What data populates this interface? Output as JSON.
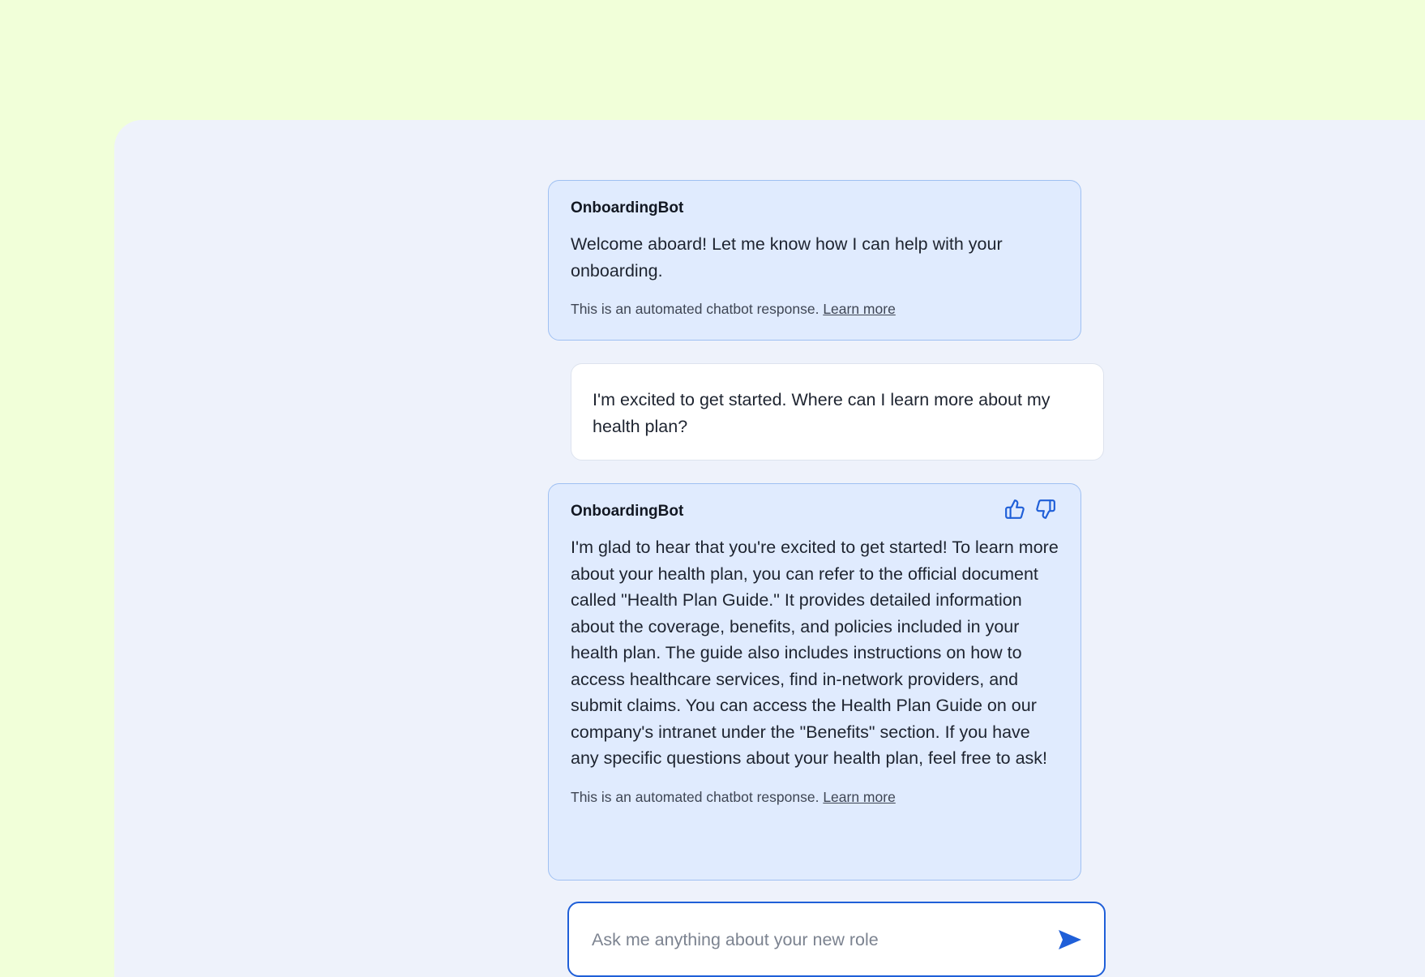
{
  "messages": [
    {
      "sender": "OnboardingBot",
      "text": "Welcome aboard! Let me know how I can help with your onboarding.",
      "disclaimer": "This is an automated chatbot response.",
      "learn_more": "Learn more"
    },
    {
      "text": "I'm excited to get started. Where can I learn more about my health plan?"
    },
    {
      "sender": "OnboardingBot",
      "text": "I'm glad to hear that you're excited to get started! To learn more about your health plan, you can refer to the official document called \"Health Plan Guide.\" It provides detailed information about the coverage, benefits, and policies included in your health plan. The guide also includes instructions on how to access healthcare services, find in-network providers, and submit claims. You can access the Health Plan Guide on our company's intranet under the \"Benefits\" section. If you have any specific questions about your health plan, feel free to ask!",
      "disclaimer": "This is an automated chatbot response.",
      "learn_more": "Learn more",
      "feedback_icons": [
        "thumbs-up-icon",
        "thumbs-down-icon"
      ]
    }
  ],
  "input": {
    "placeholder": "Ask me anything about your new role",
    "value": "",
    "send_icon": "send-icon"
  },
  "colors": {
    "page_background": "#f1ffd9",
    "panel_background": "#eef2fb",
    "bot_bubble": "#e0ebfe",
    "bot_bubble_border": "#9fc0f2",
    "accent": "#1f5fd8"
  }
}
